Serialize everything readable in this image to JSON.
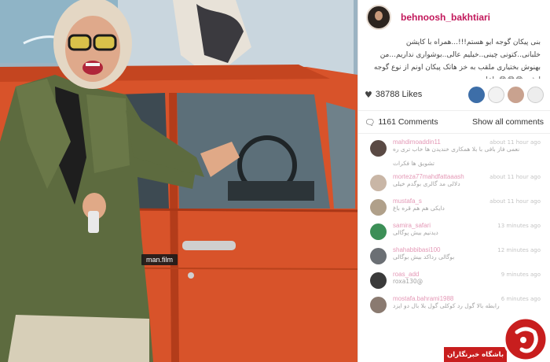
{
  "post": {
    "username": "behnoosh_bakhtiari",
    "caption": "بنی پیکان گوجه ایو هستم!!!...همراه با کاپشن خلبانی..کتونی چینی..خیلیم عالی..بوشواری نداریم...من بهنوش بختیاری ملقب به خز هاتک پیکان اونم از نوع گوجه ایشم 😂😂😂 یاعلی",
    "likes": "38788 Likes",
    "comments_count": "1161 Comments",
    "show_all": "Show all comments"
  },
  "photo": {
    "credit": "man.film"
  },
  "comments": [
    {
      "user": "mahdimoaddin11",
      "time": "about 11 hour ago",
      "text": "نعمی فاز بافی با بلا همکاری خندیدن ها خاب تری ره",
      "text2": "تشویق ها فکرات",
      "avatar_color": "#5a4a44"
    },
    {
      "user": "morteza77mahdfattaaash",
      "time": "about 11 hour ago",
      "text": "دلالی مد گالری بوگدم خیلی",
      "avatar_color": "#c9b6a6"
    },
    {
      "user": "mustafa_s",
      "time": "about 11 hour ago",
      "text": "دایکی هم هم قره باغ",
      "avatar_color": "#b0a08a"
    },
    {
      "user": "samira_safari",
      "time": "13 minutes ago",
      "text": "دیدنیم بیش پوگالی",
      "avatar_color": "#3c8f57"
    },
    {
      "user": "shahabbibasi100",
      "time": "12 minutes ago",
      "text": "بوگالی رداکد بیش بوگالی",
      "avatar_color": "#6b6f74"
    },
    {
      "user": "roas_add",
      "time": "9 minutes ago",
      "text": "@roxa130",
      "avatar_color": "#3a3a3a"
    },
    {
      "user": "mostafa.bahrami1988",
      "time": "6 minutes ago",
      "text": "رابطه بالا گول رد کوکلی گول بلا بال دو ایزد",
      "avatar_color": "#8a7a70"
    }
  ],
  "brand": {
    "name": "باشگاه خبرنگاران"
  },
  "colors": {
    "accent": "#c2185b",
    "car": "#d8532a",
    "brand": "#c81e1e"
  }
}
